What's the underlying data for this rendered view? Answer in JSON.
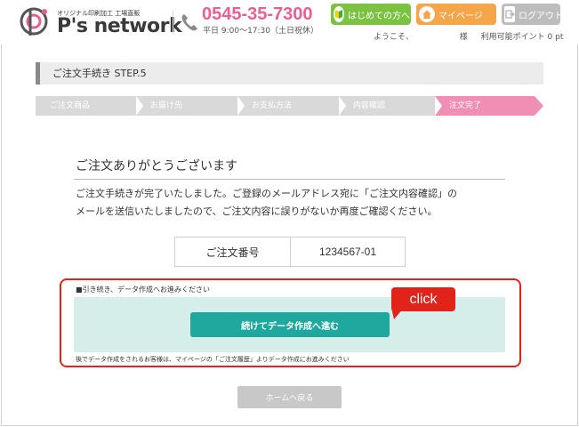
{
  "header": {
    "logo_sub": "オリジナル印刷加工 工場直販",
    "logo_text": "P's network",
    "phone": "0545-35-7300",
    "hours": "平日 9:00～17:30（土日祝休）",
    "buttons": {
      "first": "はじめての方へ",
      "mypage": "マイページ",
      "logout": "ログアウト"
    },
    "welcome": "ようこそ、",
    "honorific": "様",
    "points": "利用可能ポイント 0 pt"
  },
  "step": {
    "title": "ご注文手続き STEP.5"
  },
  "progress": {
    "steps": [
      "ご注文商品",
      "お届け先",
      "お支払方法",
      "内容確認",
      "注文完了"
    ],
    "active_index": 4,
    "colors": {
      "inactive": "#d9d9d9",
      "active": "#f08eb4"
    }
  },
  "thanks": {
    "title": "ご注文ありがとうございます",
    "line1": "ご注文手続きが完了いたしました。ご登録のメールアドレス宛に「ご注文内容確認」の",
    "line2": "メールを送信いたしましたので、ご注文内容に誤りがないか再度ご確認ください。"
  },
  "order": {
    "label": "ご注文番号",
    "number": "1234567-01"
  },
  "data_creation": {
    "note": "■引き続き、データ作成へお進みください",
    "button": "続けてデータ作成へ進む",
    "callout": "click",
    "later_note": "後でデータ作成をされるお客様は、マイページの「ご注文履歴」よりデータ作成にお進みください"
  },
  "home_button": "ホームへ戻る",
  "colors": {
    "brand_pink": "#e8608f",
    "teal": "#1fa89e",
    "teal_bg": "#d6eeea",
    "highlight_red": "#e2231a",
    "green": "#7cc242",
    "orange": "#f5a64a",
    "gray": "#bdbdbd"
  }
}
